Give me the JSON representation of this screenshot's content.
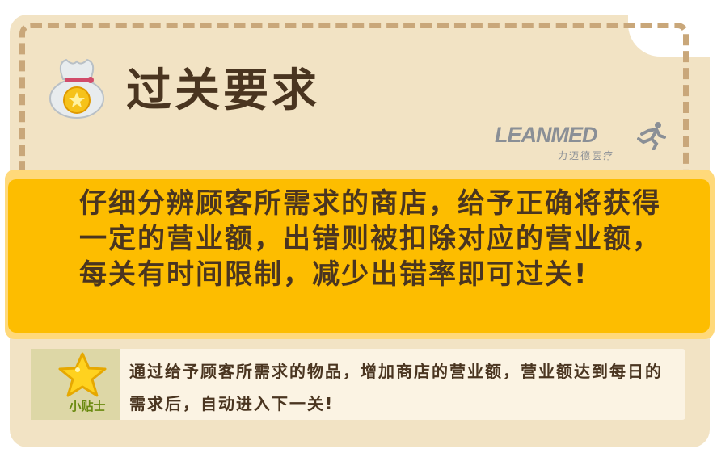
{
  "title": "过关要求",
  "brand": {
    "name": "LEANMED",
    "subtitle": "力迈德医疗"
  },
  "main_text": "仔细分辨顾客所需求的商店，给予正确将获得一定的营业额，出错则被扣除对应的营业额，每关有时间限制，减少出错率即可过关!",
  "tip": {
    "label": "小贴士",
    "text": "通过给予顾客所需求的物品，增加商店的营业额，营业额达到每日的需求后，自动进入下一关!"
  },
  "colors": {
    "card": "#f2e3c4",
    "dash": "#c9a77a",
    "panel": "#fdbd00",
    "text": "#4a3520",
    "tip_label": "#6a8a10"
  }
}
